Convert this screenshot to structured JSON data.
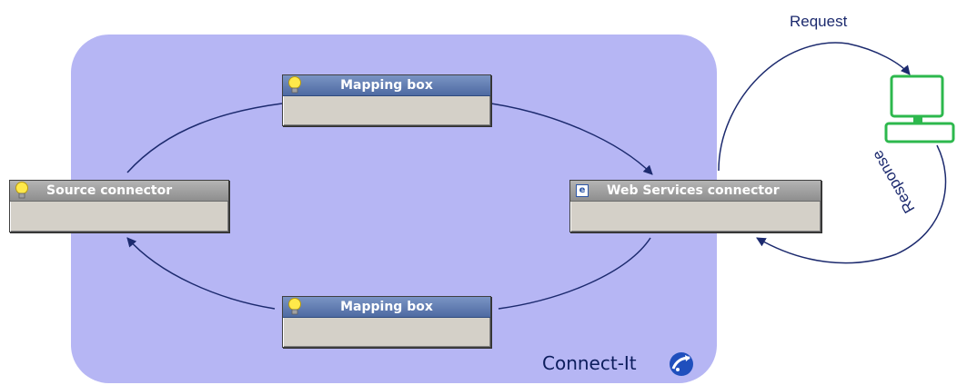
{
  "diagram": {
    "mapping_box_top": "Mapping box",
    "mapping_box_bottom": "Mapping box",
    "source_connector": "Source connector",
    "web_services_connector": "Web Services connector",
    "request_label": "Request",
    "response_label": "Response",
    "brand": "Connect-It"
  },
  "icons": {
    "mapping_top": "lightbulb-icon",
    "mapping_bottom": "lightbulb-icon",
    "source": "lightbulb-icon",
    "web_services": "web-services-icon",
    "client": "computer-icon",
    "brand": "connect-it-logo-icon"
  },
  "colors": {
    "region": "#b6b6f4",
    "arrow": "#1c2a6e",
    "title_bar": "#5a76ae",
    "box_body": "#d4d0c8",
    "computer": "#2db84d"
  }
}
